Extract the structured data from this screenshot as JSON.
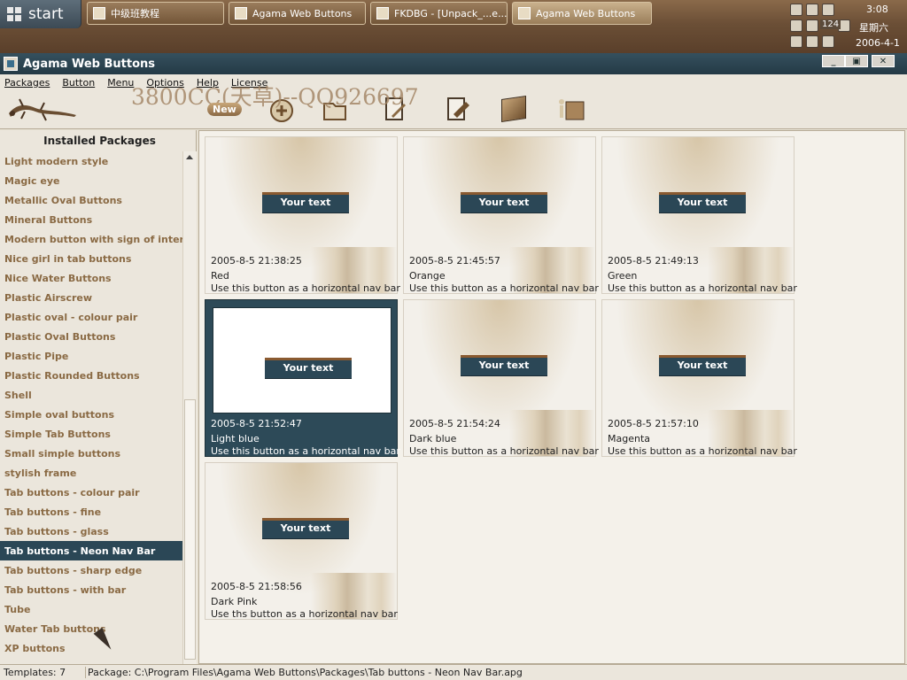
{
  "taskbar": {
    "start_label": "start",
    "tasks": [
      {
        "label": "中级班教程",
        "active": false
      },
      {
        "label": "Agama Web Buttons",
        "active": false
      },
      {
        "label": "FKDBG - [Unpack_...e...",
        "active": false
      },
      {
        "label": "Agama Web Buttons",
        "active": true
      }
    ],
    "tray": {
      "time": "3:08",
      "weekday": "星期六",
      "date": "2006-4-1",
      "badge": "124"
    }
  },
  "window": {
    "title": "Agama Web Buttons"
  },
  "menu": [
    "Packages",
    "Button",
    "Menu",
    "Options",
    "Help",
    "License"
  ],
  "toolbar": {
    "watermark": "3800CC(天草)--QQ926697",
    "new_label": "New"
  },
  "panel": {
    "header": "Installed Packages",
    "packages": [
      "Light modern style",
      "Magic eye",
      "Metallic Oval Buttons",
      "Mineral Buttons",
      "Modern button with sign of interrogation",
      "Nice girl in tab buttons",
      "Nice Water Buttons",
      "Plastic Airscrew",
      "Plastic oval - colour pair",
      "Plastic Oval Buttons",
      "Plastic Pipe",
      "Plastic Rounded Buttons",
      "Shell",
      "Simple oval buttons",
      "Simple Tab Buttons",
      "Small simple buttons",
      "stylish frame",
      "Tab buttons - colour pair",
      "Tab buttons - fine",
      "Tab buttons - glass",
      "Tab buttons - Neon Nav Bar",
      "Tab buttons - sharp edge",
      "Tab buttons - with bar",
      "Tube",
      "Water Tab buttons",
      "XP buttons"
    ],
    "selected_index": 20
  },
  "templates": [
    {
      "button_text": "Your text",
      "date": "2005-8-5 21:38:25",
      "name": "Red",
      "desc": "Use this button as a horizontal nav bar",
      "selected": false
    },
    {
      "button_text": "Your text",
      "date": "2005-8-5 21:45:57",
      "name": "Orange",
      "desc": "Use this button as a horizontal nav bar",
      "selected": false
    },
    {
      "button_text": "Your text",
      "date": "2005-8-5 21:49:13",
      "name": "Green",
      "desc": "Use this button as a horizontal nav bar",
      "selected": false
    },
    {
      "button_text": "Your text",
      "date": "2005-8-5 21:52:47",
      "name": "Light blue",
      "desc": "Use this button as a horizontal nav bar",
      "selected": true
    },
    {
      "button_text": "Your text",
      "date": "2005-8-5 21:54:24",
      "name": "Dark blue",
      "desc": "Use this button as a horizontal nav bar",
      "selected": false
    },
    {
      "button_text": "Your text",
      "date": "2005-8-5 21:57:10",
      "name": "Magenta",
      "desc": "Use this button as a horizontal nav bar",
      "selected": false
    },
    {
      "button_text": "Your text",
      "date": "2005-8-5 21:58:56",
      "name": "Dark Pink",
      "desc": "Use ths button as a horizontal nav bar",
      "selected": false
    }
  ],
  "status": {
    "count": "Templates: 7",
    "package": "Package: C:\\Program Files\\Agama Web Buttons\\Packages\\Tab buttons - Neon Nav Bar.apg"
  },
  "colors": {
    "selected_bg": "#2b4756",
    "accent_brown": "#8a6a44"
  }
}
